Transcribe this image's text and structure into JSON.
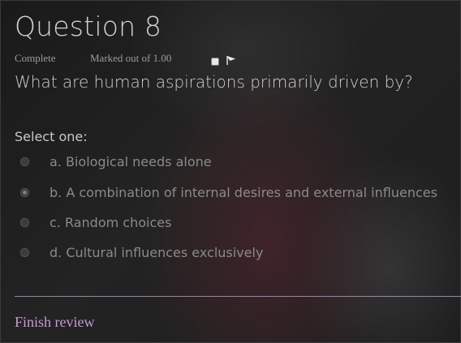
{
  "question": {
    "title": "Question 8",
    "status": "Complete",
    "grade": "Marked out of 1.00",
    "flag_checked": false,
    "flag_icon": "flag-icon",
    "text": "What are human aspirations primarily driven by?",
    "prompt": "Select one:",
    "options": [
      {
        "label": "a. Biological needs alone",
        "selected": false
      },
      {
        "label": "b. A combination of internal desires and external influences",
        "selected": true
      },
      {
        "label": "c. Random choices",
        "selected": false
      },
      {
        "label": "d. Cultural influences exclusively",
        "selected": false
      }
    ]
  },
  "footer": {
    "finish_label": "Finish review"
  },
  "colors": {
    "link": "#c79ad6",
    "divider": "#9b82a6"
  }
}
